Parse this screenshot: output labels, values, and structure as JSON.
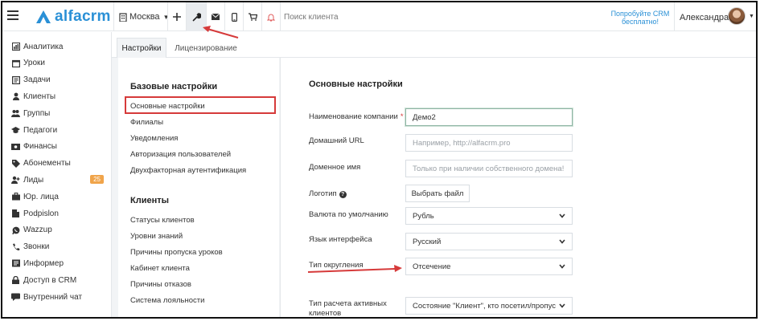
{
  "header": {
    "logo_text": "alfacrm",
    "city": "Москва",
    "search_placeholder": "Поиск клиента",
    "promo": "Попробуйте CRM бесплатно!",
    "user_name": "Александра"
  },
  "sidebar": {
    "items": [
      {
        "label": "Аналитика",
        "icon": "analytics-icon"
      },
      {
        "label": "Уроки",
        "icon": "calendar-icon"
      },
      {
        "label": "Задачи",
        "icon": "tasks-icon"
      },
      {
        "label": "Клиенты",
        "icon": "user-icon"
      },
      {
        "label": "Группы",
        "icon": "group-icon"
      },
      {
        "label": "Педагоги",
        "icon": "graduation-cap-icon"
      },
      {
        "label": "Финансы",
        "icon": "money-icon"
      },
      {
        "label": "Абонементы",
        "icon": "tag-icon"
      },
      {
        "label": "Лиды",
        "icon": "lead-icon",
        "badge": "25"
      },
      {
        "label": "Юр. лица",
        "icon": "briefcase-icon"
      },
      {
        "label": "Podpislon",
        "icon": "document-icon"
      },
      {
        "label": "Wazzup",
        "icon": "whatsapp-icon"
      },
      {
        "label": "Звонки",
        "icon": "phone-icon"
      },
      {
        "label": "Информер",
        "icon": "informer-icon"
      },
      {
        "label": "Доступ в CRM",
        "icon": "lock-icon"
      },
      {
        "label": "Внутренний чат",
        "icon": "chat-icon"
      }
    ]
  },
  "tabs": [
    {
      "label": "Настройки",
      "active": true
    },
    {
      "label": "Лицензирование",
      "active": false
    }
  ],
  "settings_menu": {
    "basic_title": "Базовые настройки",
    "basic_items": [
      "Основные настройки",
      "Филиалы",
      "Уведомления",
      "Авторизация пользователей",
      "Двухфакторная аутентификация"
    ],
    "clients_title": "Клиенты",
    "clients_items": [
      "Статусы клиентов",
      "Уровни знаний",
      "Причины пропуска уроков",
      "Кабинет клиента",
      "Причины отказов",
      "Система лояльности"
    ]
  },
  "form": {
    "title": "Основные настройки",
    "company_name": {
      "label": "Наименование компании",
      "required_mark": "*",
      "value": "Демо2"
    },
    "home_url": {
      "label": "Домашний URL",
      "placeholder": "Например, http://alfacrm.pro"
    },
    "domain": {
      "label": "Доменное имя",
      "placeholder": "Только при наличии собственного домена!"
    },
    "logo": {
      "label": "Логотип",
      "help": "?",
      "button": "Выбрать файл"
    },
    "currency": {
      "label": "Валюта по умолчанию",
      "value": "Рубль"
    },
    "language": {
      "label": "Язык интерфейса",
      "value": "Русский"
    },
    "rounding": {
      "label": "Тип округления",
      "value": "Отсечение"
    },
    "active_calc": {
      "label_line1": "Тип расчета активных",
      "label_line2": "клиентов",
      "value": "Состояние \"Клиент\", кто посетил/пропусти"
    }
  },
  "colors": {
    "brand": "#2a90d6",
    "annotation_red": "#d63a3a",
    "badge_orange": "#f0a44a"
  }
}
